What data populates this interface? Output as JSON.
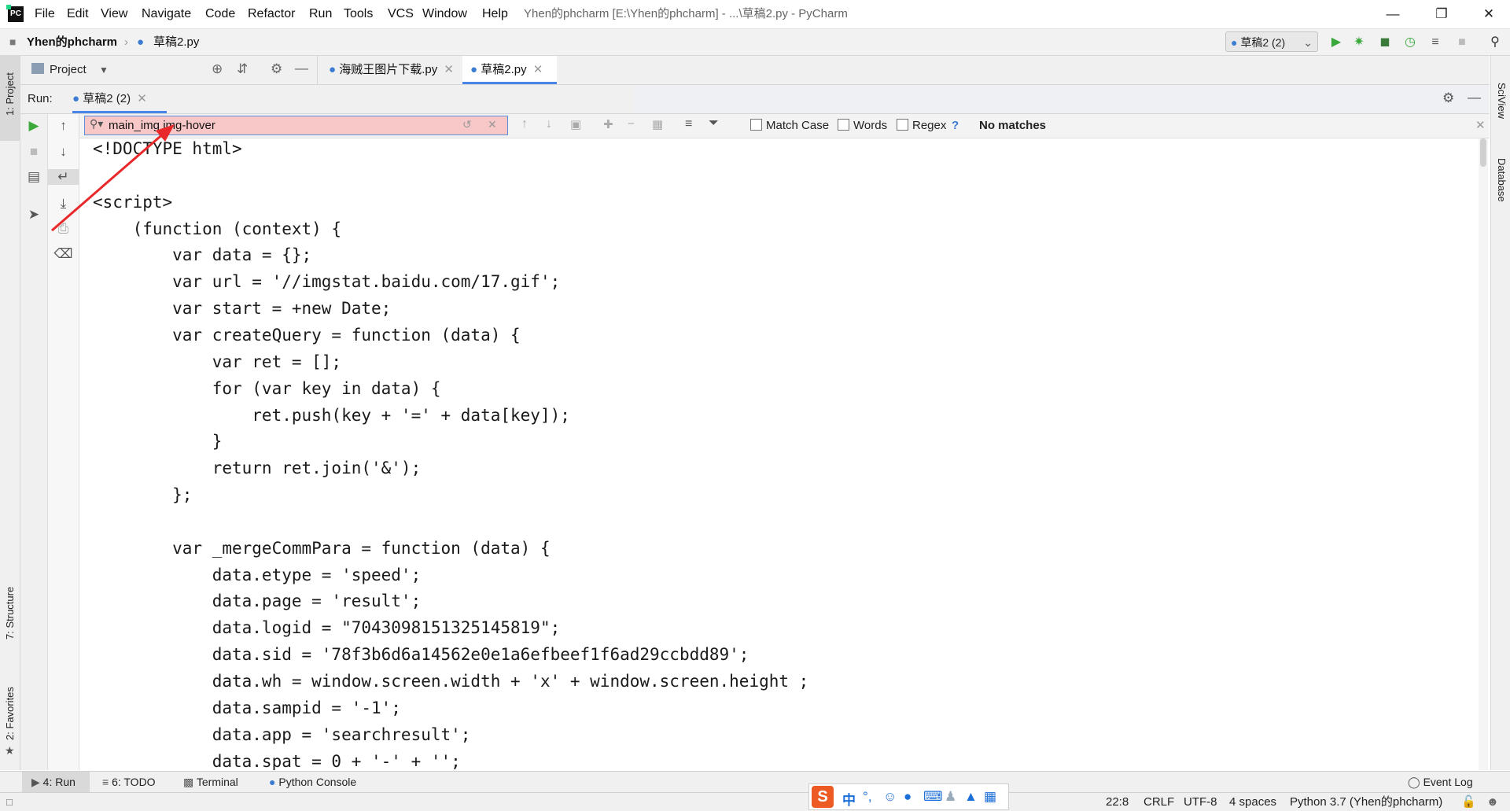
{
  "app": {
    "menu": [
      "File",
      "Edit",
      "View",
      "Navigate",
      "Code",
      "Refactor",
      "Run",
      "Tools",
      "VCS",
      "Window",
      "Help"
    ],
    "window_title": "Yhen的phcharm [E:\\Yhen的phcharm] - ...\\草稿2.py - PyCharm"
  },
  "navbar": {
    "project": "Yhen的phcharm",
    "file": "草稿2.py",
    "run_config": "草稿2 (2)"
  },
  "project_panel": {
    "label": "Project"
  },
  "editor_tabs": [
    {
      "label": "海贼王图片下载.py",
      "active": false
    },
    {
      "label": "草稿2.py",
      "active": true
    }
  ],
  "run_window": {
    "label": "Run:",
    "tab": "草稿2 (2)"
  },
  "search": {
    "query": "main_img img-hover",
    "match_case": "Match Case",
    "words": "Words",
    "regex": "Regex",
    "help": "?",
    "status": "No matches"
  },
  "code_lines": [
    "<!DOCTYPE html>",
    "",
    "<script>",
    "    (function (context) {",
    "        var data = {};",
    "        var url = '//imgstat.baidu.com/17.gif';",
    "        var start = +new Date;",
    "        var createQuery = function (data) {",
    "            var ret = [];",
    "            for (var key in data) {",
    "                ret.push(key + '=' + data[key]);",
    "            }",
    "            return ret.join('&');",
    "        };",
    "",
    "        var _mergeCommPara = function (data) {",
    "            data.etype = 'speed';",
    "            data.page = 'result';",
    "            data.logid = \"7043098151325145819\";",
    "            data.sid = '78f3b6d6a14562e0e1a6efbeef1f6ad29ccbdd89';",
    "            data.wh = window.screen.width + 'x' + window.screen.height ;",
    "            data.sampid = '-1';",
    "            data.app = 'searchresult';",
    "            data.spat = 0 + '-' + '';"
  ],
  "side_stripes": {
    "left_top": "1: Project",
    "left_mid": "7: Structure",
    "left_bottom": "2: Favorites",
    "right_top": "SciView",
    "right_bottom": "Database"
  },
  "bottom_tabs": [
    "4: Run",
    "6: TODO",
    "Terminal",
    "Python Console"
  ],
  "event_log": "Event Log",
  "status": {
    "position": "22:8",
    "line_sep": "CRLF",
    "encoding": "UTF-8",
    "indent": "4 spaces",
    "interpreter": "Python 3.7 (Yhen的phcharm)"
  },
  "ime": {
    "lang": "中"
  },
  "colors": {
    "search_bg": "#f8c8c8",
    "run_green": "#3aa83a",
    "accent_blue": "#4a86e8",
    "arrow_red": "#e8282a"
  }
}
